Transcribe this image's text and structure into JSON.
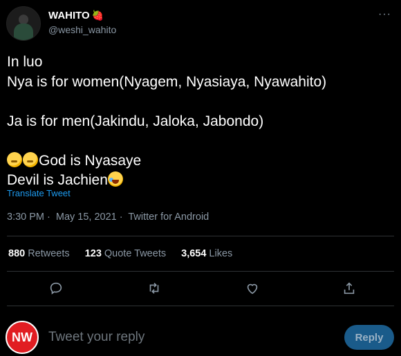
{
  "author": {
    "name": "WAHITO",
    "badge": "🍓",
    "handle": "@weshi_wahito",
    "more_label": "···"
  },
  "tweet": {
    "lines": [
      "In luo",
      "Nya is for women(Nyagem, Nyasiaya, Nyawahito)",
      "",
      "Ja is for men(Jakindu, Jaloka, Jabondo)",
      "",
      "God is Nyasaye",
      "Devil is Jachien"
    ],
    "emoji": [
      "thinking-face",
      "thinking-face",
      "face-with-tears-of-joy"
    ],
    "translate_label": "Translate Tweet"
  },
  "meta": {
    "time": "3:30 PM",
    "date": "May 15, 2021",
    "source": "Twitter for Android",
    "sep": "·"
  },
  "stats": {
    "retweets_count": "880",
    "retweets_label": "Retweets",
    "quotes_count": "123",
    "quotes_label": "Quote Tweets",
    "likes_count": "3,654",
    "likes_label": "Likes"
  },
  "actions": [
    "reply-icon",
    "retweet-icon",
    "like-icon",
    "share-icon"
  ],
  "reply": {
    "avatar_text": "NW",
    "placeholder": "Tweet your reply",
    "button_label": "Reply"
  },
  "colors": {
    "background": "#000000",
    "text": "#ffffff",
    "muted": "#8b98a5",
    "link": "#1d9bf0",
    "divider": "#2f3336",
    "reply_button": "#1a5b8a",
    "nw_red": "#e11d22"
  }
}
